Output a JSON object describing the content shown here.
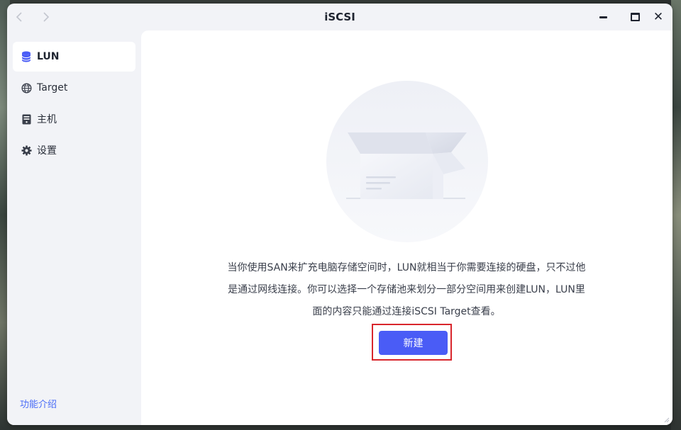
{
  "window": {
    "title": "iSCSI",
    "back_icon": "chevron-left-icon",
    "forward_icon": "chevron-right-icon",
    "close_label": "✕"
  },
  "sidebar": {
    "items": [
      {
        "label": "LUN",
        "icon": "database-icon",
        "active": true
      },
      {
        "label": "Target",
        "icon": "globe-icon",
        "active": false
      },
      {
        "label": "主机",
        "icon": "server-icon",
        "active": false
      },
      {
        "label": "设置",
        "icon": "gear-icon",
        "active": false
      }
    ],
    "footer_link": "功能介绍"
  },
  "main": {
    "empty_state": {
      "illustration": "empty-box-illustration",
      "lines": [
        "当你使用SAN来扩充电脑存储空间时，LUN就相当于你需要连接的硬盘，只不过他",
        "是通过网线连接。你可以选择一个存储池来划分一部分空间用来创建LUN，LUN里",
        "面的内容只能通过连接iSCSI Target查看。"
      ],
      "create_button": "新建"
    }
  },
  "colors": {
    "accent": "#4a5cf6",
    "link": "#4a6cf7",
    "highlight_border": "#d8262c",
    "window_bg": "#f2f3f7",
    "content_bg": "#ffffff"
  }
}
